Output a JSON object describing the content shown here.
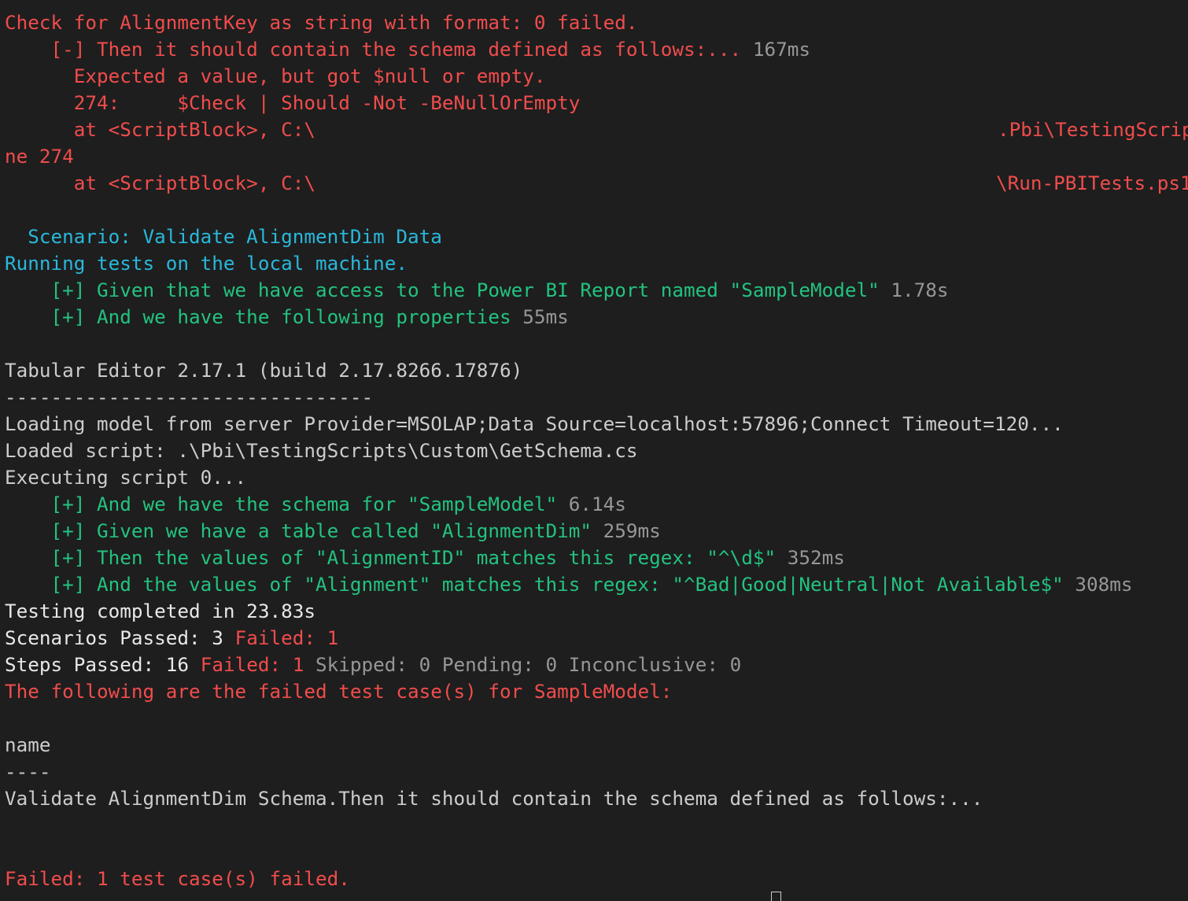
{
  "terminal": {
    "colors": {
      "background": "#1e1e1e",
      "default": "#cccccc",
      "bright": "#e8e8e8",
      "red": "#f14c4c",
      "green": "#23c27f",
      "cyan": "#29b8db",
      "gray": "#979797"
    },
    "failed_check": {
      "header": "Check for AlignmentKey as string with format: 0 failed.",
      "step": "    [-] Then it should contain the schema defined as follows:...",
      "step_duration": " 167ms",
      "message": "      Expected a value, but got $null or empty.",
      "code_line": "      274:     $Check | Should -Not -BeNullOrEmpty",
      "trace1_left": "      at <ScriptBlock>, C:\\",
      "trace1_right": ".Pbi\\TestingScrip",
      "trace1_wrap": "ne 274",
      "trace2_left": "      at <ScriptBlock>, C:\\",
      "trace2_right": "\\Run-PBITests.ps1"
    },
    "scenario": {
      "title": "  Scenario: Validate AlignmentDim Data",
      "running": "Running tests on the local machine.",
      "steps": [
        {
          "text": "    [+] Given that we have access to the Power BI Report named \"SampleModel\"",
          "duration": " 1.78s"
        },
        {
          "text": "    [+] And we have the following properties",
          "duration": " 55ms"
        }
      ]
    },
    "tabular_editor": {
      "version": "Tabular Editor 2.17.1 (build 2.17.8266.17876)",
      "separator": "--------------------------------",
      "loading": "Loading model from server Provider=MSOLAP;Data Source=localhost:57896;Connect Timeout=120...",
      "loaded_script": "Loaded script: .\\Pbi\\TestingScripts\\Custom\\GetSchema.cs",
      "executing": "Executing script 0..."
    },
    "more_steps": [
      {
        "text": "    [+] And we have the schema for \"SampleModel\"",
        "duration": " 6.14s"
      },
      {
        "text": "    [+] Given we have a table called \"AlignmentDim\"",
        "duration": " 259ms"
      },
      {
        "text": "    [+] Then the values of \"AlignmentID\" matches this regex: \"^\\d$\"",
        "duration": " 352ms"
      },
      {
        "text": "    [+] And the values of \"Alignment\" matches this regex: \"^Bad|Good|Neutral|Not Available$\"",
        "duration": " 308ms"
      }
    ],
    "summary": {
      "completed": "Testing completed in 23.83s",
      "scenarios_passed": "Scenarios Passed: 3",
      "scenarios_failed": " Failed: 1",
      "steps_passed": "Steps Passed: 16",
      "steps_failed": " Failed: 1",
      "steps_other": " Skipped: 0 Pending: 0 Inconclusive: 0",
      "failed_cases_header": "The following are the failed test case(s) for SampleModel:"
    },
    "failed_table": {
      "column": "name",
      "underline": "----",
      "rows": [
        "Validate AlignmentDim Schema.Then it should contain the schema defined as follows:..."
      ]
    },
    "final": "Failed: 1 test case(s) failed."
  }
}
